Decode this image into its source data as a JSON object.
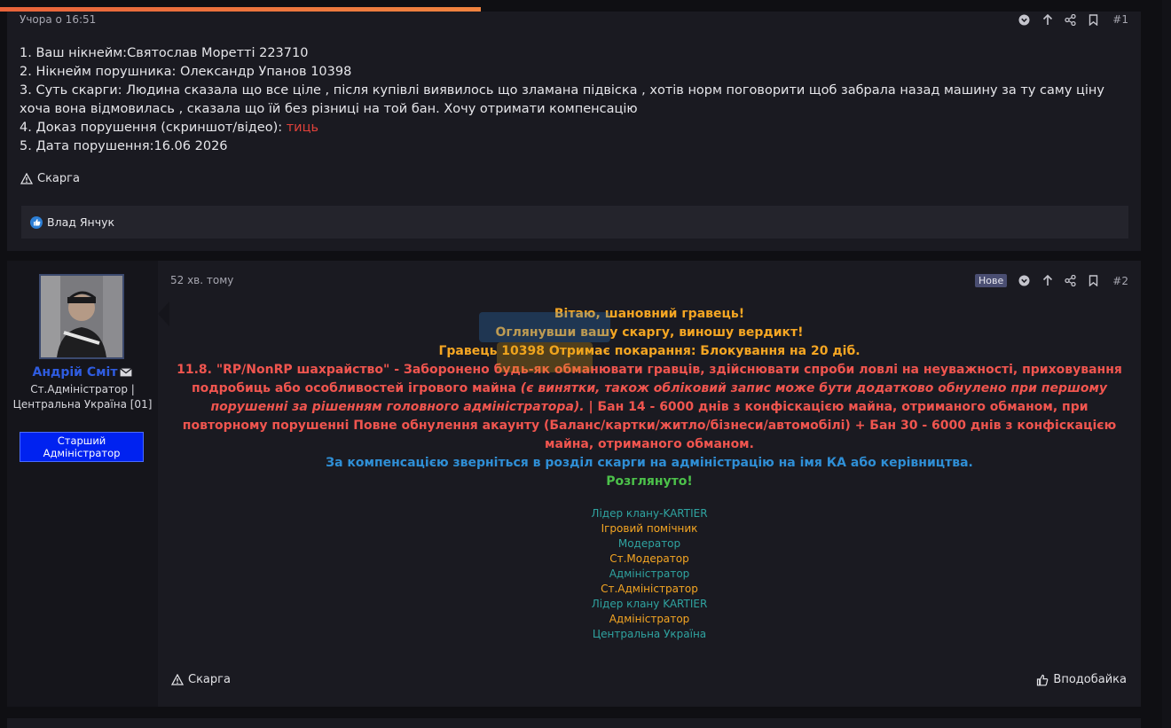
{
  "post1": {
    "time": "Учора о 16:51",
    "number": "#1",
    "lines": [
      "1. Ваш нікнейм:Святослав Моретті 223710",
      "2. Нікнейм порушника: Олександр Упанов 10398",
      "3. Суть скарги: Людина сказала що все ціле , після купівлі виявилось що зламана підвіска , хотів норм поговорити щоб забрала назад машину за ту саму ціну хоча вона відмовилась , сказала що їй без різниці на той бан. Хочу отримати компенсацію"
    ],
    "proof_label": "4. Доказ порушення (скриншот/відео): ",
    "proof_link": "тиць",
    "date_line": "5. Дата порушення:16.06 2026",
    "report_label": "Скарга",
    "liked_by": "Влад Янчук"
  },
  "post2": {
    "time": "52 хв. тому",
    "new_badge": "Нове",
    "number": "#2",
    "author": {
      "name": "Андрій Сміт",
      "title": "Ст.Адміністратор | Центральна Україна [01]",
      "badge": "Старший Адміністратор"
    },
    "greeting": "Вітаю, шановний гравець!",
    "verdict_intro": "Оглянувши вашу скаргу, виношу вердикт!",
    "punishment": "Гравець 10398 Отримає покарання: Блокування на 20 діб.",
    "rule_text_1": "11.8. \"RP/NonRP шахрайство\" - Заборонено будь-як обманювати гравців, здійснювати спроби ловлі на неуважності, приховування подробиць або особливостей ігрового майна ",
    "rule_text_italic": "(є винятки, також обліковий запис може бути додатково обнулено при першому порушенні за рішенням головного адміністратора).",
    "rule_text_2": " | Бан 14 - 6000 днів з конфіскацією майна, отриманого обманом, при повторному порушенні Повне обнулення акаунту (Баланс/картки/житло/бізнеси/автомобілі) + Бан 30 - 6000 днів з конфіскацією майна, отриманого обманом.",
    "compensation": "За компенсацією зверніться в розділ скарги на адміністрацію на імя КА або керівництва.",
    "status": "Розглянуто!",
    "signature": [
      "Лідер клану-KARTIER",
      "Ігровий помічник",
      "Модератор",
      "Ст.Модератор",
      "Адміністратор",
      "Ст.Адміністратор",
      "Лідер клану KARTIER",
      "Адміністратор",
      "Центральна Україна"
    ],
    "report_label": "Скарга",
    "like_label": "Вподобайка"
  },
  "colors": {
    "orange": "#f5a623",
    "red": "#f0554f",
    "blue": "#2f8fd6",
    "green": "#4cc14a",
    "teal": "#2fa3a0",
    "badge_blue": "#0022f0"
  },
  "icons": [
    "chevron-down-icon",
    "arrow-up-icon",
    "share-icon",
    "bookmark-icon",
    "warning-icon",
    "like-icon",
    "mail-icon"
  ]
}
